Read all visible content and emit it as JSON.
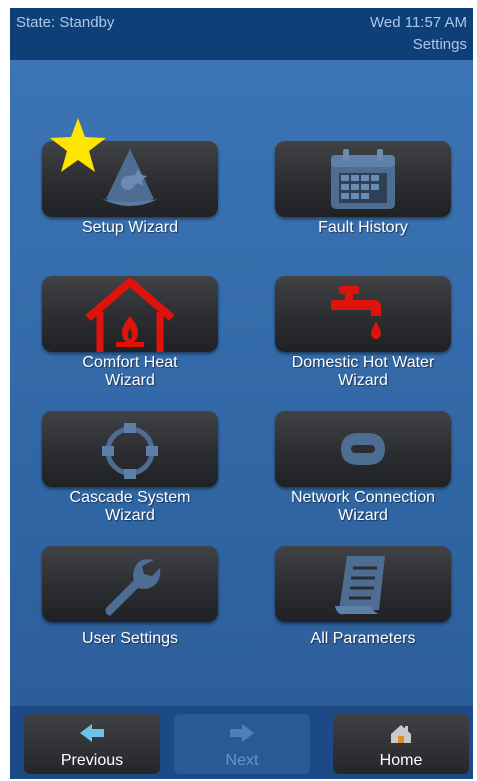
{
  "status_bar": {
    "state": "State: Standby",
    "datetime": "Wed 11:57 AM",
    "screen_name": "Settings"
  },
  "menu": [
    {
      "label": "Setup Wizard",
      "icon": "wizard-hat-icon",
      "starred": true
    },
    {
      "label": "Fault History",
      "icon": "calendar-icon"
    },
    {
      "label": "Comfort Heat\nWizard",
      "icon": "house-flame-icon",
      "icon_color": "#e0120c"
    },
    {
      "label": "Domestic Hot Water\nWizard",
      "icon": "faucet-icon",
      "icon_color": "#e0120c"
    },
    {
      "label": "Cascade System\nWizard",
      "icon": "cascade-network-icon"
    },
    {
      "label": "Network Connection\nWizard",
      "icon": "network-link-icon"
    },
    {
      "label": "User Settings",
      "icon": "wrench-icon"
    },
    {
      "label": "All Parameters",
      "icon": "parameter-list-icon"
    }
  ],
  "nav": {
    "previous": "Previous",
    "next": "Next",
    "home": "Home",
    "next_enabled": false
  },
  "colors": {
    "background": "#3d76b6",
    "header": "#0f3f77",
    "accent_red": "#e0120c",
    "star": "#ffe600"
  }
}
